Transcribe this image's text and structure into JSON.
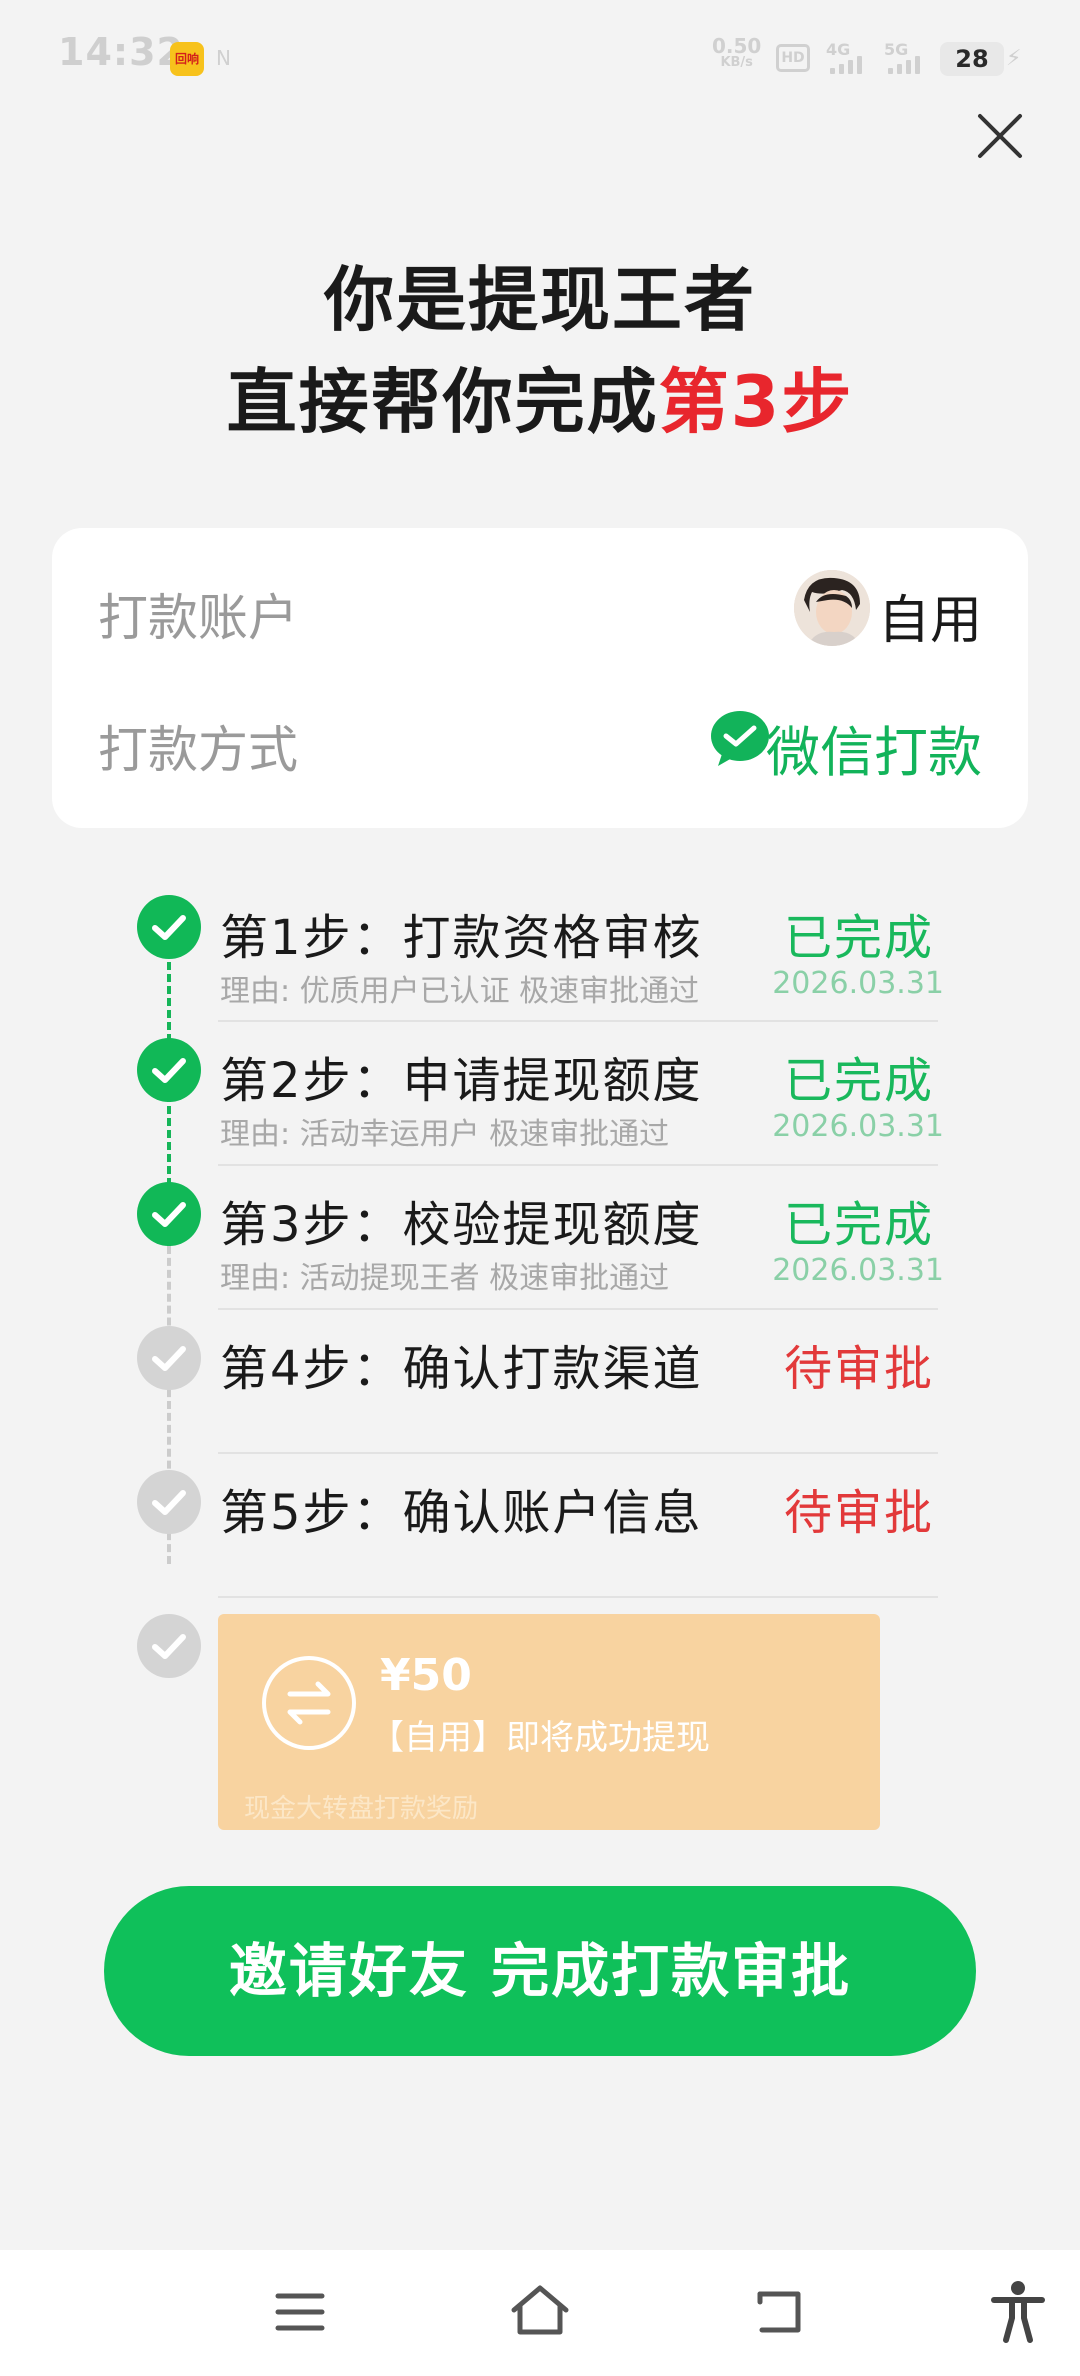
{
  "status_bar": {
    "time": "14:32",
    "app_icon_text": "回响",
    "net_speed_value": "0.50",
    "net_speed_unit": "KB/s",
    "hd_label": "HD",
    "signal_4g": "4G",
    "signal_5g": "5G",
    "battery": "28"
  },
  "header": {
    "title_line1": "你是提现王者",
    "title_line2_prefix": "直接帮你完成",
    "title_line2_highlight": "第3步"
  },
  "payment": {
    "account_label": "打款账户",
    "account_name": "自用",
    "method_label": "打款方式",
    "method_value": "微信打款"
  },
  "steps": [
    {
      "title": "第1步：打款资格审核",
      "status": "已完成",
      "reason": "理由: 优质用户已认证 极速审批通过",
      "date": "2026.03.31",
      "state": "done"
    },
    {
      "title": "第2步：申请提现额度",
      "status": "已完成",
      "reason": "理由: 活动幸运用户 极速审批通过",
      "date": "2026.03.31",
      "state": "done"
    },
    {
      "title": "第3步：校验提现额度",
      "status": "已完成",
      "reason": "理由: 活动提现王者 极速审批通过",
      "date": "2026.03.31",
      "state": "done"
    },
    {
      "title": "第4步：确认打款渠道",
      "status": "待审批",
      "reason": "",
      "date": "",
      "state": "pending"
    },
    {
      "title": "第5步：确认账户信息",
      "status": "待审批",
      "reason": "",
      "date": "",
      "state": "pending"
    }
  ],
  "reward": {
    "amount": "¥50",
    "text": "【自用】即将成功提现",
    "footnote": "现金大转盘打款奖励"
  },
  "cta": {
    "label": "邀请好友 完成打款审批"
  },
  "colors": {
    "primary_green": "#0fc05a",
    "pending_red": "#e2393a",
    "reward_orange": "#f8d3a0",
    "highlight_red": "#e8262d"
  },
  "icons": [
    "close-icon",
    "wechat-icon",
    "check-icon",
    "exchange-icon",
    "menu-icon",
    "home-icon",
    "back-icon",
    "accessibility-icon"
  ]
}
